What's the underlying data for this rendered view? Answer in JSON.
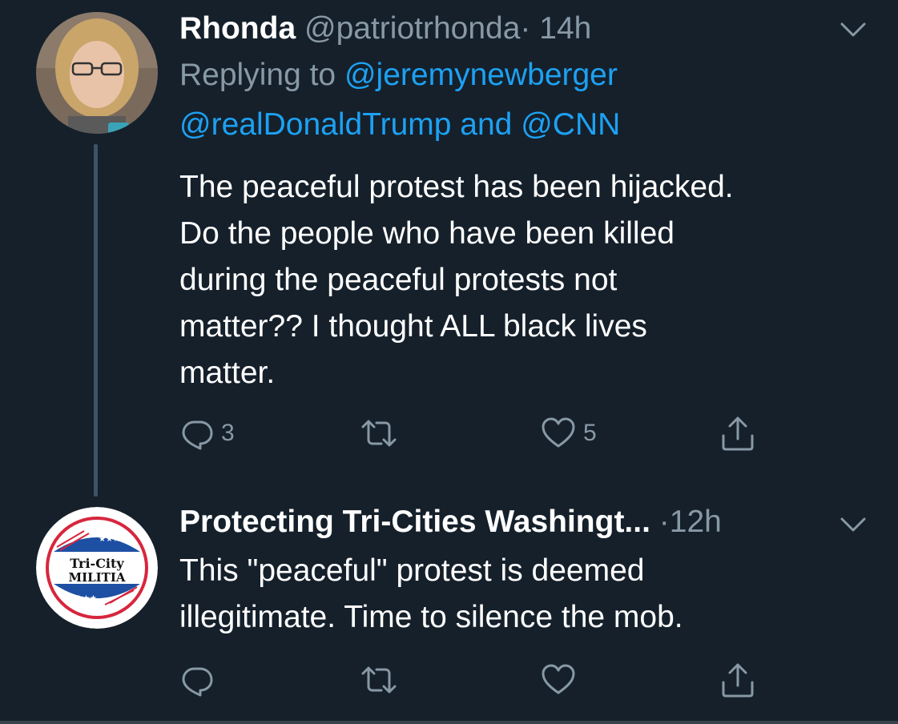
{
  "tweets": [
    {
      "name": "Rhonda",
      "handle": "@patriotrhonda",
      "sep": "·",
      "time": "14h",
      "reply_prefix": "Replying to",
      "reply_user1": "@jeremynewberger",
      "reply_user2": "@realDonaldTrump",
      "reply_and": "and",
      "reply_user3": "@CNN",
      "lines": [
        "The peaceful protest has been hijacked.",
        "Do the people who have been killed",
        "during the peaceful protests not",
        "matter??  I thought ALL black lives",
        "matter."
      ],
      "replies": "3",
      "likes": "5"
    },
    {
      "name": "Protecting Tri-Cities Washingt...",
      "sep": "·",
      "time": "12h",
      "lines": [
        "This \"peaceful\" protest is deemed",
        "illegitimate. Time to silence the mob."
      ],
      "avatar_text_top": "Tri-City",
      "avatar_text_bottom": "MILITIA",
      "avatar_stars": "★★★★"
    }
  ],
  "colors": {
    "background": "#15202b",
    "link": "#1da1f2",
    "secondary": "#8899a6",
    "thread_line": "#3d5466"
  },
  "icons": [
    "reply-icon",
    "retweet-icon",
    "like-icon",
    "share-icon",
    "chevron-down-icon"
  ]
}
